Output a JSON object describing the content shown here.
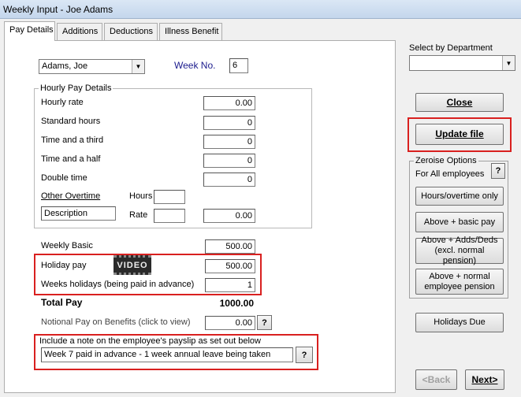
{
  "window": {
    "title": "Weekly Input - Joe Adams"
  },
  "tabs": [
    {
      "label": "Pay Details"
    },
    {
      "label": "Additions"
    },
    {
      "label": "Deductions"
    },
    {
      "label": "Illness Benefit"
    }
  ],
  "employee": {
    "selected": "Adams, Joe"
  },
  "week": {
    "label": "Week No.",
    "value": "6"
  },
  "hourly": {
    "group_label": "Hourly Pay Details",
    "rate_label": "Hourly rate",
    "rate_value": "0.00",
    "standard_label": "Standard hours",
    "standard_value": "0",
    "third_label": "Time and a third",
    "third_value": "0",
    "half_label": "Time and a half",
    "half_value": "0",
    "double_label": "Double time",
    "double_value": "0",
    "other_overtime_label": "Other Overtime",
    "hours_label": "Hours",
    "hours_value": "",
    "description_value": "Description",
    "rate2_label": "Rate",
    "rate2_value": "",
    "other_amount": "0.00"
  },
  "pay": {
    "weekly_basic_label": "Weekly Basic",
    "weekly_basic_value": "500.00",
    "holiday_label": "Holiday pay",
    "holiday_value": "500.00",
    "video_label": "VIDEO",
    "weeks_holidays_label": "Weeks holidays (being paid in advance)",
    "weeks_holidays_value": "1",
    "total_label": "Total Pay",
    "total_value": "1000.00",
    "notional_label": "Notional Pay on Benefits (click to view)",
    "notional_value": "0.00"
  },
  "note": {
    "label": "Include a note on the employee's payslip as set out below",
    "value": "Week 7 paid in advance - 1 week annual leave being taken"
  },
  "help_glyph": "?",
  "side": {
    "department_label": "Select by Department",
    "department_value": "",
    "close": "Close",
    "update": "Update file",
    "zeroise_label": "Zeroise Options",
    "for_all": "For All employees",
    "hours_overtime": "Hours/overtime only",
    "basic_pay": "Above + basic pay",
    "adds_deds": "Above + Adds/Deds (excl. normal pension)",
    "normal_pension": "Above + normal employee pension",
    "holidays_due": "Holidays Due",
    "back": "<Back",
    "next": "Next>"
  },
  "colors": {
    "highlight": "#d9201f",
    "label_blue": "#1a1a8c"
  }
}
